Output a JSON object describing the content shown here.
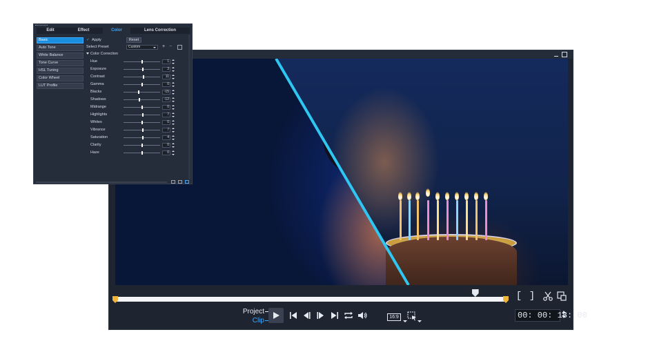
{
  "color_panel": {
    "tabs": [
      {
        "label": "Edit",
        "active": false
      },
      {
        "label": "Effect",
        "active": false
      },
      {
        "label": "Color",
        "active": true
      },
      {
        "label": "Lens Correction",
        "active": false
      }
    ],
    "categories": [
      {
        "label": "Basic",
        "active": true
      },
      {
        "label": "Auto Tone",
        "active": false
      },
      {
        "label": "White Balance",
        "active": false
      },
      {
        "label": "Tone Curve",
        "active": false
      },
      {
        "label": "HSL Tuning",
        "active": false
      },
      {
        "label": "Color Wheel",
        "active": false
      },
      {
        "label": "LUT Profile",
        "active": false
      }
    ],
    "apply_label": "Apply",
    "apply_checked": true,
    "reset_label": "Reset",
    "select_preset_label": "Select Preset",
    "preset_value": "Custom",
    "add_preset_glyph": "+",
    "remove_preset_glyph": "−",
    "section_label": "Color Correction",
    "sliders": [
      {
        "label": "Hue",
        "value": 1,
        "level": 0.5
      },
      {
        "label": "Exposure",
        "value": 3,
        "level": 0.52
      },
      {
        "label": "Contrast",
        "value": 11,
        "level": 0.55
      },
      {
        "label": "Gamma",
        "value": 0,
        "level": 0.5
      },
      {
        "label": "Blacks",
        "value": -15,
        "level": 0.42
      },
      {
        "label": "Shadows",
        "value": -12,
        "level": 0.44
      },
      {
        "label": "Midrange",
        "value": 0,
        "level": 0.5
      },
      {
        "label": "Highlights",
        "value": 7,
        "level": 0.53
      },
      {
        "label": "Whites",
        "value": 0,
        "level": 0.5
      },
      {
        "label": "Vibrance",
        "value": 7,
        "level": 0.53
      },
      {
        "label": "Saturation",
        "value": 4,
        "level": 0.52
      },
      {
        "label": "Clarity",
        "value": 0,
        "level": 0.5
      },
      {
        "label": "Haze",
        "value": 0,
        "level": 0.5
      }
    ]
  },
  "player": {
    "mark_in_glyph": "[",
    "mark_out_glyph": "]",
    "mode_project": "Project",
    "mode_clip": "Clip",
    "aspect_ratio": "16:9",
    "timecode": "00: 00: 18: 00",
    "scrubber_position": 0.92,
    "icons": [
      "minimize-icon",
      "maximize-icon",
      "scissors-icon",
      "extract-icon",
      "play-icon",
      "home-icon",
      "previous-frame-icon",
      "next-frame-icon",
      "end-icon",
      "repeat-icon",
      "volume-icon",
      "aspect-ratio-icon",
      "preview-area-icon"
    ]
  },
  "colors": {
    "accent": "#3fa9ff",
    "trim_marker": "#f0b43a",
    "split_line": "#2fc6f2",
    "panel_bg": "#262d3a",
    "player_bg": "#1e2430"
  }
}
